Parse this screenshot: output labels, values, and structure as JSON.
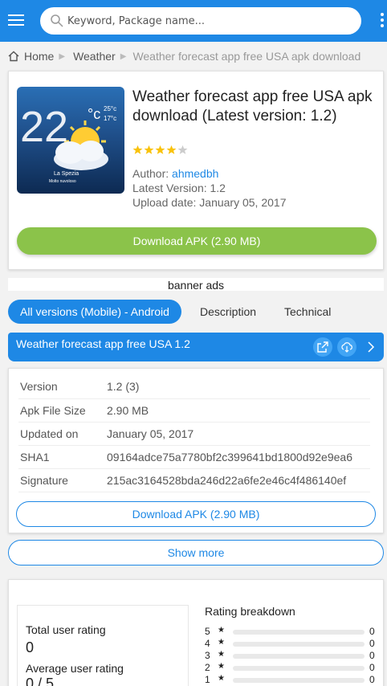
{
  "header": {
    "search_placeholder": "Keyword, Package name..."
  },
  "breadcrumb": {
    "home": "Home",
    "category": "Weather",
    "current": "Weather forecast app free USA apk download"
  },
  "app": {
    "title": "Weather forecast app free USA apk download (Latest version: 1.2)",
    "rating_stars": 4,
    "author_label": "Author:",
    "author": "ahmedbh",
    "latest_version": "Latest Version: 1.2",
    "upload_date": "Upload date: January 05, 2017",
    "download_label": "Download APK (2.90 MB)",
    "icon": {
      "temperature": "22",
      "unit": "°c",
      "high": "25°c",
      "low": "17°c",
      "city": "La Spezia",
      "condition": "Molto nuvoloso"
    }
  },
  "banner": "banner ads",
  "tabs": [
    {
      "label": "All versions (Mobile) - Android",
      "active": true
    },
    {
      "label": "Description",
      "active": false
    },
    {
      "label": "Technical",
      "active": false
    }
  ],
  "version_bar": {
    "title": "Weather forecast app free USA 1.2"
  },
  "details": {
    "rows": [
      {
        "key": "Version",
        "value": "1.2 (3)"
      },
      {
        "key": "Apk File Size",
        "value": "2.90 MB"
      },
      {
        "key": "Updated on",
        "value": "January 05, 2017"
      },
      {
        "key": "SHA1",
        "value": "09164adce75a7780bf2c399641bd1800d92e9ea6"
      },
      {
        "key": "Signature",
        "value": "215ac3164528bda246d22a6fe2e46c4f486140ef"
      }
    ],
    "download_label": "Download APK (2.90 MB)"
  },
  "show_more": "Show more",
  "rating": {
    "total_label": "Total user rating",
    "total_value": "0",
    "average_label": "Average user rating",
    "average_value": "0 / 5",
    "breakdown_title": "Rating breakdown",
    "breakdown": [
      {
        "stars": "5",
        "count": "0"
      },
      {
        "stars": "4",
        "count": "0"
      },
      {
        "stars": "3",
        "count": "0"
      },
      {
        "stars": "2",
        "count": "0"
      },
      {
        "stars": "1",
        "count": "0"
      }
    ],
    "star_glyph": "★"
  },
  "colors": {
    "primary": "#1e88e5",
    "download_green": "#8bc34a",
    "star": "#f9c20a"
  }
}
